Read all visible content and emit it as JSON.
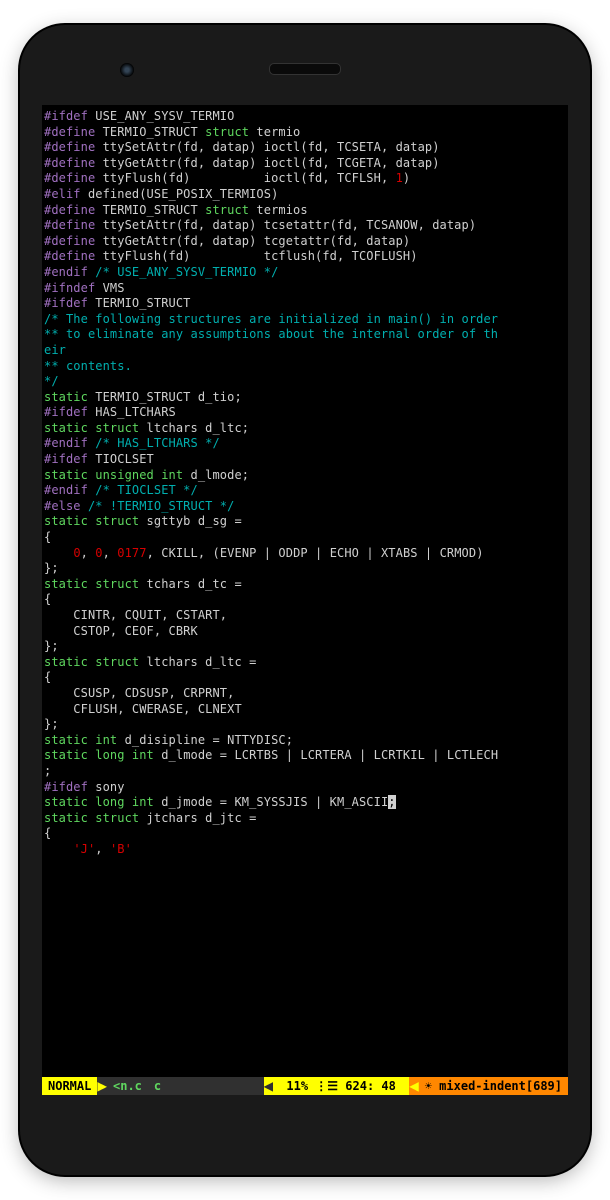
{
  "code_lines": [
    [
      [
        "pp",
        "#ifdef"
      ],
      [
        "id",
        " USE_ANY_SYSV_TERMIO"
      ]
    ],
    [
      [
        "pp",
        "#define"
      ],
      [
        "id",
        " TERMIO_STRUCT "
      ],
      [
        "kw",
        "struct"
      ],
      [
        "id",
        " termio"
      ]
    ],
    [
      [
        "pp",
        "#define"
      ],
      [
        "id",
        " ttySetAttr(fd, datap) ioctl(fd, TCSETA, datap)"
      ]
    ],
    [
      [
        "pp",
        "#define"
      ],
      [
        "id",
        " ttyGetAttr(fd, datap) ioctl(fd, TCGETA, datap)"
      ]
    ],
    [
      [
        "pp",
        "#define"
      ],
      [
        "id",
        " ttyFlush(fd)          ioctl(fd, TCFLSH, "
      ],
      [
        "nm",
        "1"
      ],
      [
        "id",
        ")"
      ]
    ],
    [
      [
        "pp",
        "#elif"
      ],
      [
        "id",
        " defined(USE_POSIX_TERMIOS)"
      ]
    ],
    [
      [
        "pp",
        "#define"
      ],
      [
        "id",
        " TERMIO_STRUCT "
      ],
      [
        "kw",
        "struct"
      ],
      [
        "id",
        " termios"
      ]
    ],
    [
      [
        "pp",
        "#define"
      ],
      [
        "id",
        " ttySetAttr(fd, datap) tcsetattr(fd, TCSANOW, datap)"
      ]
    ],
    [
      [
        "pp",
        "#define"
      ],
      [
        "id",
        " ttyGetAttr(fd, datap) tcgetattr(fd, datap)"
      ]
    ],
    [
      [
        "pp",
        "#define"
      ],
      [
        "id",
        " ttyFlush(fd)          tcflush(fd, TCOFLUSH)"
      ]
    ],
    [
      [
        "pp",
        "#endif"
      ],
      [
        "cm",
        " /* USE_ANY_SYSV_TERMIO */"
      ]
    ],
    [
      [
        "id",
        ""
      ]
    ],
    [
      [
        "pp",
        "#ifndef"
      ],
      [
        "id",
        " VMS"
      ]
    ],
    [
      [
        "pp",
        "#ifdef"
      ],
      [
        "id",
        " TERMIO_STRUCT"
      ]
    ],
    [
      [
        "cm",
        "/* The following structures are initialized in main() in order"
      ]
    ],
    [
      [
        "cm",
        "** to eliminate any assumptions about the internal order of th"
      ]
    ],
    [
      [
        "cm",
        "eir"
      ]
    ],
    [
      [
        "cm",
        "** contents."
      ]
    ],
    [
      [
        "cm",
        "*/"
      ]
    ],
    [
      [
        "kw",
        "static"
      ],
      [
        "id",
        " TERMIO_STRUCT d_tio;"
      ]
    ],
    [
      [
        "id",
        ""
      ]
    ],
    [
      [
        "pp",
        "#ifdef"
      ],
      [
        "id",
        " HAS_LTCHARS"
      ]
    ],
    [
      [
        "kw",
        "static"
      ],
      [
        "id",
        " "
      ],
      [
        "kw",
        "struct"
      ],
      [
        "id",
        " ltchars d_ltc;"
      ]
    ],
    [
      [
        "pp",
        "#endif"
      ],
      [
        "cm",
        " /* HAS_LTCHARS */"
      ]
    ],
    [
      [
        "id",
        ""
      ]
    ],
    [
      [
        "pp",
        "#ifdef"
      ],
      [
        "id",
        " TIOCLSET"
      ]
    ],
    [
      [
        "kw",
        "static"
      ],
      [
        "id",
        " "
      ],
      [
        "kw",
        "unsigned int"
      ],
      [
        "id",
        " d_lmode;"
      ]
    ],
    [
      [
        "pp",
        "#endif"
      ],
      [
        "cm",
        " /* TIOCLSET */"
      ]
    ],
    [
      [
        "id",
        ""
      ]
    ],
    [
      [
        "pp",
        "#else"
      ],
      [
        "cm",
        " /* !TERMIO_STRUCT */"
      ]
    ],
    [
      [
        "kw",
        "static"
      ],
      [
        "id",
        " "
      ],
      [
        "kw",
        "struct"
      ],
      [
        "id",
        " sgttyb d_sg ="
      ]
    ],
    [
      [
        "id",
        "{"
      ]
    ],
    [
      [
        "id",
        "    "
      ],
      [
        "nm",
        "0"
      ],
      [
        "id",
        ", "
      ],
      [
        "nm",
        "0"
      ],
      [
        "id",
        ", "
      ],
      [
        "nm",
        "0177"
      ],
      [
        "id",
        ", CKILL, (EVENP | ODDP | ECHO | XTABS | CRMOD)"
      ]
    ],
    [
      [
        "id",
        "};"
      ]
    ],
    [
      [
        "kw",
        "static"
      ],
      [
        "id",
        " "
      ],
      [
        "kw",
        "struct"
      ],
      [
        "id",
        " tchars d_tc ="
      ]
    ],
    [
      [
        "id",
        "{"
      ]
    ],
    [
      [
        "id",
        "    CINTR, CQUIT, CSTART,"
      ]
    ],
    [
      [
        "id",
        "    CSTOP, CEOF, CBRK"
      ]
    ],
    [
      [
        "id",
        "};"
      ]
    ],
    [
      [
        "kw",
        "static"
      ],
      [
        "id",
        " "
      ],
      [
        "kw",
        "struct"
      ],
      [
        "id",
        " ltchars d_ltc ="
      ]
    ],
    [
      [
        "id",
        "{"
      ]
    ],
    [
      [
        "id",
        "    CSUSP, CDSUSP, CRPRNT,"
      ]
    ],
    [
      [
        "id",
        "    CFLUSH, CWERASE, CLNEXT"
      ]
    ],
    [
      [
        "id",
        "};"
      ]
    ],
    [
      [
        "kw",
        "static"
      ],
      [
        "id",
        " "
      ],
      [
        "kw",
        "int"
      ],
      [
        "id",
        " d_disipline = NTTYDISC;"
      ]
    ],
    [
      [
        "kw",
        "static"
      ],
      [
        "id",
        " "
      ],
      [
        "kw",
        "long int"
      ],
      [
        "id",
        " d_lmode = LCRTBS | LCRTERA | LCRTKIL | LCTLECH"
      ]
    ],
    [
      [
        "id",
        ";"
      ]
    ],
    [
      [
        "pp",
        "#ifdef"
      ],
      [
        "id",
        " sony"
      ]
    ],
    [
      [
        "kw",
        "static"
      ],
      [
        "id",
        " "
      ],
      [
        "kw",
        "long int"
      ],
      [
        "id",
        " d_jmode = KM_SYSSJIS | KM_ASCII"
      ],
      [
        "cursor",
        ";"
      ]
    ],
    [
      [
        "kw",
        "static"
      ],
      [
        "id",
        " "
      ],
      [
        "kw",
        "struct"
      ],
      [
        "id",
        " jtchars d_jtc ="
      ]
    ],
    [
      [
        "id",
        "{"
      ]
    ],
    [
      [
        "id",
        "    "
      ],
      [
        "nm",
        "'J'"
      ],
      [
        "id",
        ", "
      ],
      [
        "nm",
        "'B'"
      ]
    ]
  ],
  "statusbar": {
    "mode": " NORMAL ",
    "file": "<n.c",
    "filetype": "c",
    "position": " 11% ⋮☰ 624: 48 ",
    "warning": "☀ mixed-indent[689]"
  }
}
